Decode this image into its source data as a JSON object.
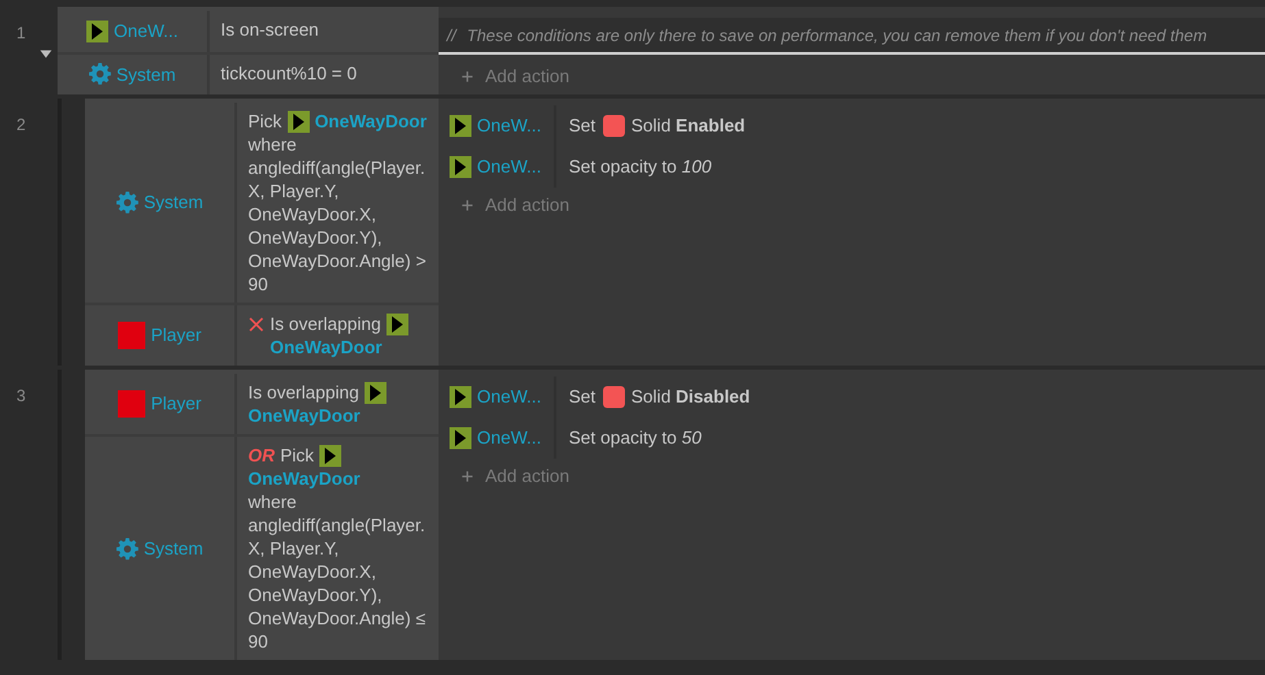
{
  "events": [
    {
      "number": "1",
      "expanded": true,
      "conditions": [
        {
          "object": {
            "kind": "sprite",
            "name": "OneW..."
          },
          "inverted": false,
          "parts": [
            {
              "kind": "text",
              "text": "Is on-screen"
            }
          ]
        },
        {
          "object": {
            "kind": "system",
            "name": "System"
          },
          "inverted": false,
          "parts": [
            {
              "kind": "text",
              "text": "tickcount%10 = 0"
            }
          ]
        }
      ],
      "comment": {
        "marker": "//",
        "text": "These conditions are only there to save on performance, you can remove them if you don't need them"
      },
      "add_action": "Add action",
      "children": [
        {
          "number": "2",
          "conditions": [
            {
              "object": {
                "kind": "system",
                "name": "System"
              },
              "inverted": false,
              "parts": [
                {
                  "kind": "text",
                  "text": "Pick"
                },
                {
                  "kind": "sprite"
                },
                {
                  "kind": "name",
                  "text": "OneWayDoor"
                },
                {
                  "kind": "text",
                  "text": "where anglediff(angle(Player. X, Player.Y, OneWayDoor.X, OneWayDoor.Y), OneWayDoor.Angle) > 90"
                }
              ]
            },
            {
              "object": {
                "kind": "player",
                "name": "Player"
              },
              "inverted": true,
              "parts": [
                {
                  "kind": "text",
                  "text": "Is overlapping"
                },
                {
                  "kind": "sprite"
                },
                {
                  "kind": "name",
                  "text": "OneWayDoor"
                }
              ]
            }
          ],
          "actions": [
            {
              "object": {
                "kind": "sprite",
                "name": "OneW..."
              },
              "parts": [
                {
                  "kind": "text",
                  "text": "Set"
                },
                {
                  "kind": "behavior"
                },
                {
                  "kind": "text",
                  "text": "Solid **Enabled**"
                }
              ]
            },
            {
              "object": {
                "kind": "sprite",
                "name": "OneW..."
              },
              "parts": [
                {
                  "kind": "text",
                  "text": "Set opacity to *100*"
                }
              ]
            }
          ],
          "add_action": "Add action"
        },
        {
          "number": "3",
          "conditions": [
            {
              "object": {
                "kind": "player",
                "name": "Player"
              },
              "inverted": false,
              "parts": [
                {
                  "kind": "text",
                  "text": "Is overlapping"
                },
                {
                  "kind": "sprite"
                },
                {
                  "kind": "name",
                  "text": "OneWayDoor"
                }
              ]
            },
            {
              "object": {
                "kind": "system",
                "name": "System"
              },
              "inverted": false,
              "parts": [
                {
                  "kind": "or",
                  "text": "OR"
                },
                {
                  "kind": "text",
                  "text": "Pick"
                },
                {
                  "kind": "sprite"
                },
                {
                  "kind": "name",
                  "text": "OneWayDoor"
                },
                {
                  "kind": "text",
                  "text": "where anglediff(angle(Player. X, Player.Y, OneWayDoor.X, OneWayDoor.Y), OneWayDoor.Angle) ≤ 90"
                }
              ]
            }
          ],
          "actions": [
            {
              "object": {
                "kind": "sprite",
                "name": "OneW..."
              },
              "parts": [
                {
                  "kind": "text",
                  "text": "Set"
                },
                {
                  "kind": "behavior"
                },
                {
                  "kind": "text",
                  "text": "Solid **Disabled**"
                }
              ]
            },
            {
              "object": {
                "kind": "sprite",
                "name": "OneW..."
              },
              "parts": [
                {
                  "kind": "text",
                  "text": "Set opacity to *50*"
                }
              ]
            }
          ],
          "add_action": "Add action"
        }
      ]
    }
  ]
}
